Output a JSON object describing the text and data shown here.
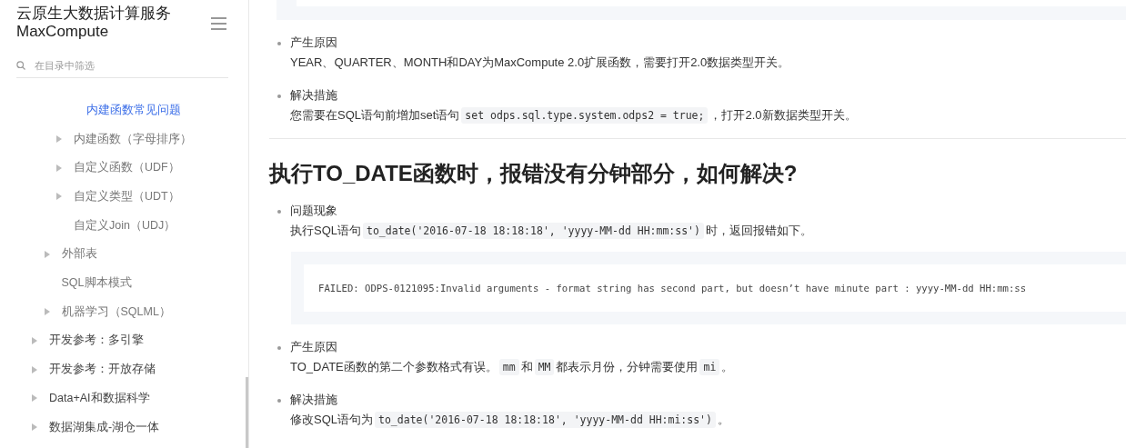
{
  "sidebar": {
    "title": "云原生大数据计算服务",
    "subtitle": "MaxCompute",
    "filter": {
      "placeholder": "在目录中筛选"
    },
    "tree": [
      {
        "children": [
          {
            "children": [
              {
                "children": [
                  {
                    "label": "内建函数常见问题",
                    "selected": true,
                    "kind": "page"
                  }
                ]
              },
              {
                "label": "内建函数（字母排序）",
                "selected": false,
                "kind": "folder"
              },
              {
                "label": "自定义函数（UDF）",
                "selected": false,
                "kind": "folder"
              },
              {
                "label": "自定义类型（UDT）",
                "selected": false,
                "kind": "folder"
              },
              {
                "label": "自定义Join（UDJ）",
                "selected": false,
                "kind": "page"
              }
            ]
          },
          {
            "label": "外部表",
            "selected": false,
            "kind": "folder"
          },
          {
            "label": "SQL脚本模式",
            "selected": false,
            "kind": "page"
          },
          {
            "label": "机器学习（SQLML）",
            "selected": false,
            "kind": "folder"
          }
        ]
      },
      {
        "label": "开发参考：多引擎",
        "selected": false,
        "kind": "folder"
      },
      {
        "label": "开发参考：开放存储",
        "selected": false,
        "kind": "folder"
      },
      {
        "label": "Data+AI和数据科学",
        "selected": false,
        "kind": "folder"
      },
      {
        "label": "数据湖集成-湖仓一体",
        "selected": false,
        "kind": "folder"
      }
    ]
  },
  "content": [
    {
      "kind": "code_fragment"
    },
    {
      "kind": "bullet",
      "title": "产生原因",
      "body": [
        {
          "text": "YEAR、QUARTER、MONTH和DAY为MaxCompute 2.0扩展函数，需要打开2.0数据类型开关。",
          "code": false
        }
      ]
    },
    {
      "kind": "bullet",
      "title": "解决措施",
      "body": [
        {
          "text": "您需要在SQL语句前增加set语句",
          "code": false
        },
        {
          "text": "set odps.sql.type.system.odps2 = true;",
          "code": true
        },
        {
          "text": "，打开2.0新数据类型开关。",
          "code": false
        }
      ]
    },
    {
      "kind": "divider"
    },
    {
      "kind": "heading",
      "text": "执行TO_DATE函数时，报错没有分钟部分，如何解决?"
    },
    {
      "kind": "bullet",
      "title": "问题现象",
      "body": [
        {
          "text": "执行SQL语句",
          "code": false
        },
        {
          "text": "to_date('2016-07-18 18:18:18', 'yyyy-MM-dd HH:mm:ss')",
          "code": true
        },
        {
          "text": "时，返回报错如下。",
          "code": false
        }
      ]
    },
    {
      "kind": "code_block",
      "text": "FAILED: ODPS-0121095:Invalid arguments - format string has second part, but doesn’t have minute part : yyyy-MM-dd HH:mm:ss"
    },
    {
      "kind": "bullet",
      "title": "产生原因",
      "body": [
        {
          "text": "TO_DATE函数的第二个参数格式有误。",
          "code": false
        },
        {
          "text": "mm",
          "code": true
        },
        {
          "text": "和",
          "code": false
        },
        {
          "text": "MM",
          "code": true
        },
        {
          "text": "都表示月份，分钟需要使用",
          "code": false
        },
        {
          "text": "mi",
          "code": true
        },
        {
          "text": "。",
          "code": false
        }
      ]
    },
    {
      "kind": "bullet",
      "title": "解决措施",
      "body": [
        {
          "text": "修改SQL语句为",
          "code": false
        },
        {
          "text": "to_date('2016-07-18 18:18:18', 'yyyy-MM-dd HH:mi:ss')",
          "code": true
        },
        {
          "text": "。",
          "code": false
        }
      ]
    }
  ]
}
